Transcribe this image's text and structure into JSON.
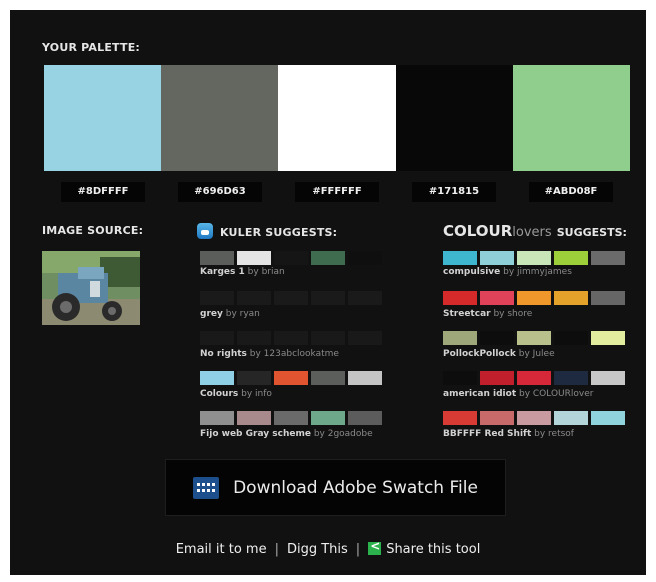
{
  "palette": {
    "title": "YOUR PALETTE:",
    "colors": [
      {
        "hex_label": "#8DFFFF",
        "fill": "#97d3e2"
      },
      {
        "hex_label": "#696D63",
        "fill": "#646760"
      },
      {
        "hex_label": "#FFFFFF",
        "fill": "#ffffff"
      },
      {
        "hex_label": "#171815",
        "fill": "#070807"
      },
      {
        "hex_label": "#ABD08F",
        "fill": "#8fce8d"
      }
    ]
  },
  "image_source": {
    "title": "IMAGE SOURCE:"
  },
  "kuler": {
    "title": "KULER SUGGESTS:",
    "items": [
      {
        "name": "Karges 1",
        "by": "by brian",
        "colors": [
          "#5a5d59",
          "#e4e4e4",
          "#151515",
          "#3f6b4e",
          "#0f0f0f"
        ]
      },
      {
        "name": "grey",
        "by": "by ryan",
        "colors": [
          "#1a1a1a",
          "#1a1a1a",
          "#1a1a1a",
          "#1a1a1a",
          "#1a1a1a"
        ]
      },
      {
        "name": "No rights",
        "by": "by 123abclookatme",
        "colors": [
          "#191919",
          "#191919",
          "#191919",
          "#191919",
          "#191919"
        ]
      },
      {
        "name": "Colours",
        "by": "by info",
        "colors": [
          "#8fd0e6",
          "#262626",
          "#e0542f",
          "#5b5e5b",
          "#c4c4c4"
        ]
      },
      {
        "name": "Fijo web Gray scheme",
        "by": "by 2goadobe",
        "colors": [
          "#8f8f8f",
          "#a88a8d",
          "#6a6a6a",
          "#6ea88a",
          "#5c5c5c"
        ]
      }
    ]
  },
  "colourlovers": {
    "title_brand": "COLOUR",
    "title_brand_suffix": "lovers",
    "title_rest": "SUGGESTS:",
    "items": [
      {
        "name": "compulsive",
        "by": "by jimmyjames",
        "colors": [
          "#3fb6cf",
          "#8fd0d8",
          "#c9e6b8",
          "#9ccf3a",
          "#6b6b6b"
        ]
      },
      {
        "name": "Streetcar",
        "by": "by shore",
        "colors": [
          "#d62a2a",
          "#e0425a",
          "#f0972b",
          "#e4a22a",
          "#666666"
        ]
      },
      {
        "name": "PollockPollock",
        "by": "by Julee",
        "colors": [
          "#9ea77a",
          "#0d0d0d",
          "#b9c08b",
          "#0d0d0d",
          "#e3ed9e"
        ]
      },
      {
        "name": "american idiot",
        "by": "by COLOURlover",
        "colors": [
          "#0d0d0d",
          "#c21f2c",
          "#d7283a",
          "#1d2a3f",
          "#c7c7c7"
        ]
      },
      {
        "name": "BBFFFF Red Shift",
        "by": "by retsof",
        "colors": [
          "#d83a34",
          "#c96a6a",
          "#c99aa0",
          "#b3d4d8",
          "#8fd3dc"
        ]
      }
    ]
  },
  "download": {
    "label": "Download Adobe Swatch File"
  },
  "footer": {
    "email": "Email it to me",
    "sep": "|",
    "digg": "Digg This",
    "share": "Share this tool"
  }
}
